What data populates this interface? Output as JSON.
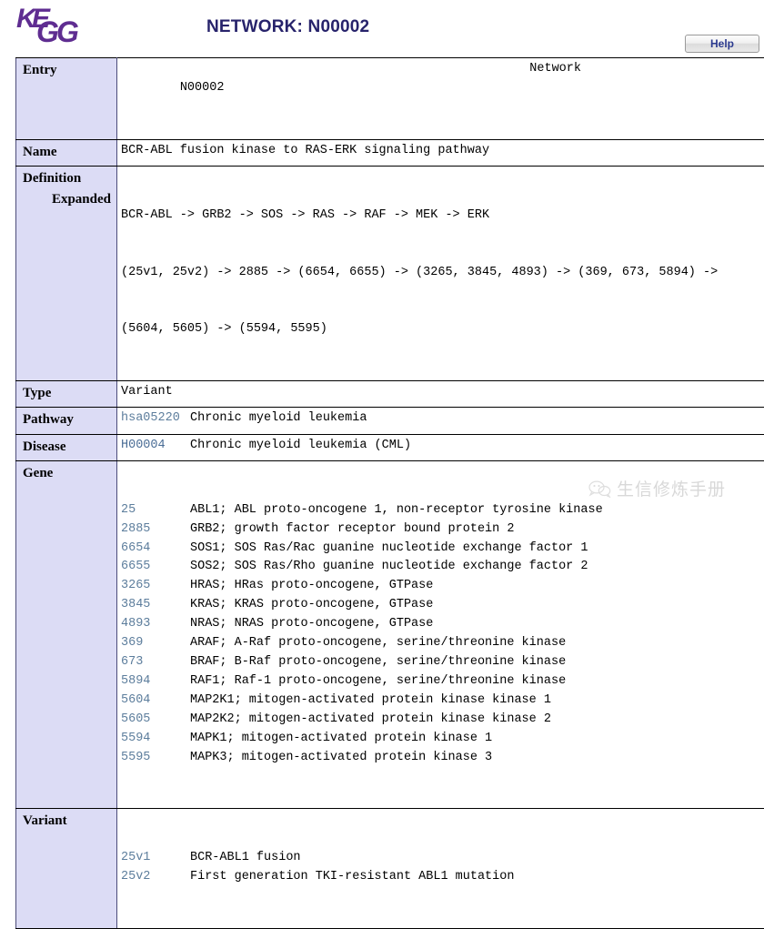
{
  "header": {
    "logo_alt": "KEGG",
    "title": "NETWORK: N00002",
    "help_label": "Help"
  },
  "table": {
    "entry": {
      "label": "Entry",
      "value": "N00002",
      "right_value": "Network"
    },
    "name": {
      "label": "Name",
      "value": "BCR-ABL fusion kinase to RAS-ERK signaling pathway"
    },
    "definition": {
      "label": "Definition",
      "value": "BCR-ABL -> GRB2 -> SOS -> RAS -> RAF -> MEK -> ERK",
      "expanded_label": "Expanded",
      "expanded_line1": "(25v1, 25v2) -> 2885 -> (6654, 6655) -> (3265, 3845, 4893) -> (369, 673, 5894) ->",
      "expanded_line2": "(5604, 5605) -> (5594, 5595)"
    },
    "type": {
      "label": "Type",
      "value": "Variant"
    },
    "pathway": {
      "label": "Pathway",
      "id": "hsa05220",
      "description": "Chronic myeloid leukemia"
    },
    "disease": {
      "label": "Disease",
      "id": "H00004",
      "description": "Chronic myeloid leukemia (CML)"
    },
    "gene": {
      "label": "Gene",
      "rows": [
        {
          "id": "25",
          "description": "ABL1; ABL proto-oncogene 1, non-receptor tyrosine kinase"
        },
        {
          "id": "2885",
          "description": "GRB2; growth factor receptor bound protein 2"
        },
        {
          "id": "6654",
          "description": "SOS1; SOS Ras/Rac guanine nucleotide exchange factor 1"
        },
        {
          "id": "6655",
          "description": "SOS2; SOS Ras/Rho guanine nucleotide exchange factor 2"
        },
        {
          "id": "3265",
          "description": "HRAS; HRas proto-oncogene, GTPase"
        },
        {
          "id": "3845",
          "description": "KRAS; KRAS proto-oncogene, GTPase"
        },
        {
          "id": "4893",
          "description": "NRAS; NRAS proto-oncogene, GTPase"
        },
        {
          "id": "369",
          "description": "ARAF; A-Raf proto-oncogene, serine/threonine kinase"
        },
        {
          "id": "673",
          "description": "BRAF; B-Raf proto-oncogene, serine/threonine kinase"
        },
        {
          "id": "5894",
          "description": "RAF1; Raf-1 proto-oncogene, serine/threonine kinase"
        },
        {
          "id": "5604",
          "description": "MAP2K1; mitogen-activated protein kinase kinase 1"
        },
        {
          "id": "5605",
          "description": "MAP2K2; mitogen-activated protein kinase kinase 2"
        },
        {
          "id": "5594",
          "description": "MAPK1; mitogen-activated protein kinase 1"
        },
        {
          "id": "5595",
          "description": "MAPK3; mitogen-activated protein kinase 3"
        }
      ]
    },
    "variant": {
      "label": "Variant",
      "rows": [
        {
          "id": "25v1",
          "description": "BCR-ABL1 fusion"
        },
        {
          "id": "25v2",
          "description": "First generation TKI-resistant ABL1 mutation"
        }
      ]
    }
  },
  "watermark": {
    "text": "生信修炼手册",
    "icon": "wechat-icon"
  },
  "colors": {
    "label_background": "#dcdcf5",
    "link": "#5c7d9c",
    "title": "#27236b",
    "logo": "#5f2d91"
  }
}
